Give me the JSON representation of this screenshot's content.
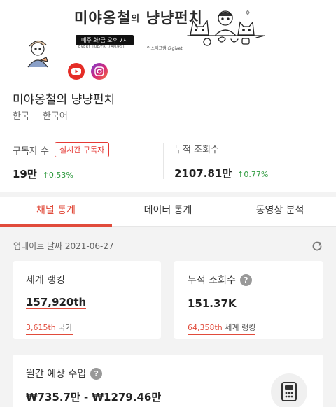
{
  "banner": {
    "title_part1": "미야옹철",
    "title_part2": "의",
    "title_part3": "냥냥펀치",
    "schedule": "매주 화/금 오후 7시",
    "schedule_sub": "EVERY TUE/FRI 7AM/PST",
    "instagram_handle": "인스타그램 @givet"
  },
  "channel": {
    "name": "미야옹철의 냥냥펀치",
    "country": "한국",
    "language": "한국어"
  },
  "stats": {
    "subscribers_label": "구독자 수",
    "live_badge": "실시간 구독자",
    "subscribers_value": "19만",
    "subscribers_change": "↑0.53%",
    "views_label": "누적 조회수",
    "views_value": "2107.81만",
    "views_change": "↑0.77%"
  },
  "tabs": [
    {
      "label": "채널 통계",
      "active": true
    },
    {
      "label": "데이터 통계",
      "active": false
    },
    {
      "label": "동영상 분석",
      "active": false
    }
  ],
  "content": {
    "updated": "업데이트 날짜 2021-06-27",
    "world_rank": {
      "title": "세계 랭킹",
      "value": "157,920th",
      "sub_num": "3,615th",
      "sub_label": "국가"
    },
    "cumulative_views": {
      "title": "누적 조회수",
      "value": "151.37K",
      "sub_num": "64,358th",
      "sub_label": "세계 랭킹"
    },
    "monthly_income": {
      "title": "월간 예상 수입",
      "value": "₩735.7만 - ₩1279.46만"
    }
  },
  "colors": {
    "accent": "#e14b3b",
    "positive": "#2e9a3e",
    "youtube": "#e52d27"
  }
}
